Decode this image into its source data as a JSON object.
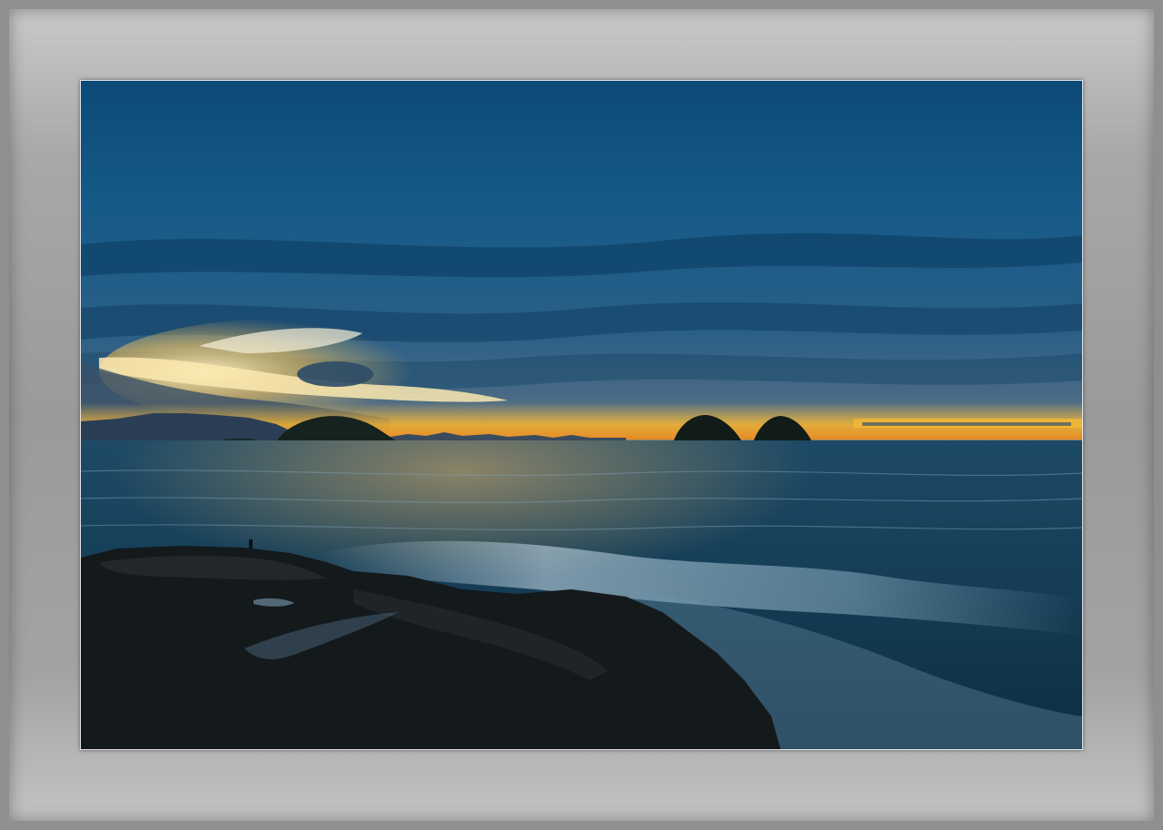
{
  "scene": {
    "subject": "seascape-sunset",
    "colors": {
      "frame": "#9c9c9c",
      "sky_top": "#0d4f7a",
      "sky_mid": "#1a5a86",
      "glow": "#f6b73c",
      "sea": "#123c55",
      "rocks": "#141a1e"
    }
  }
}
